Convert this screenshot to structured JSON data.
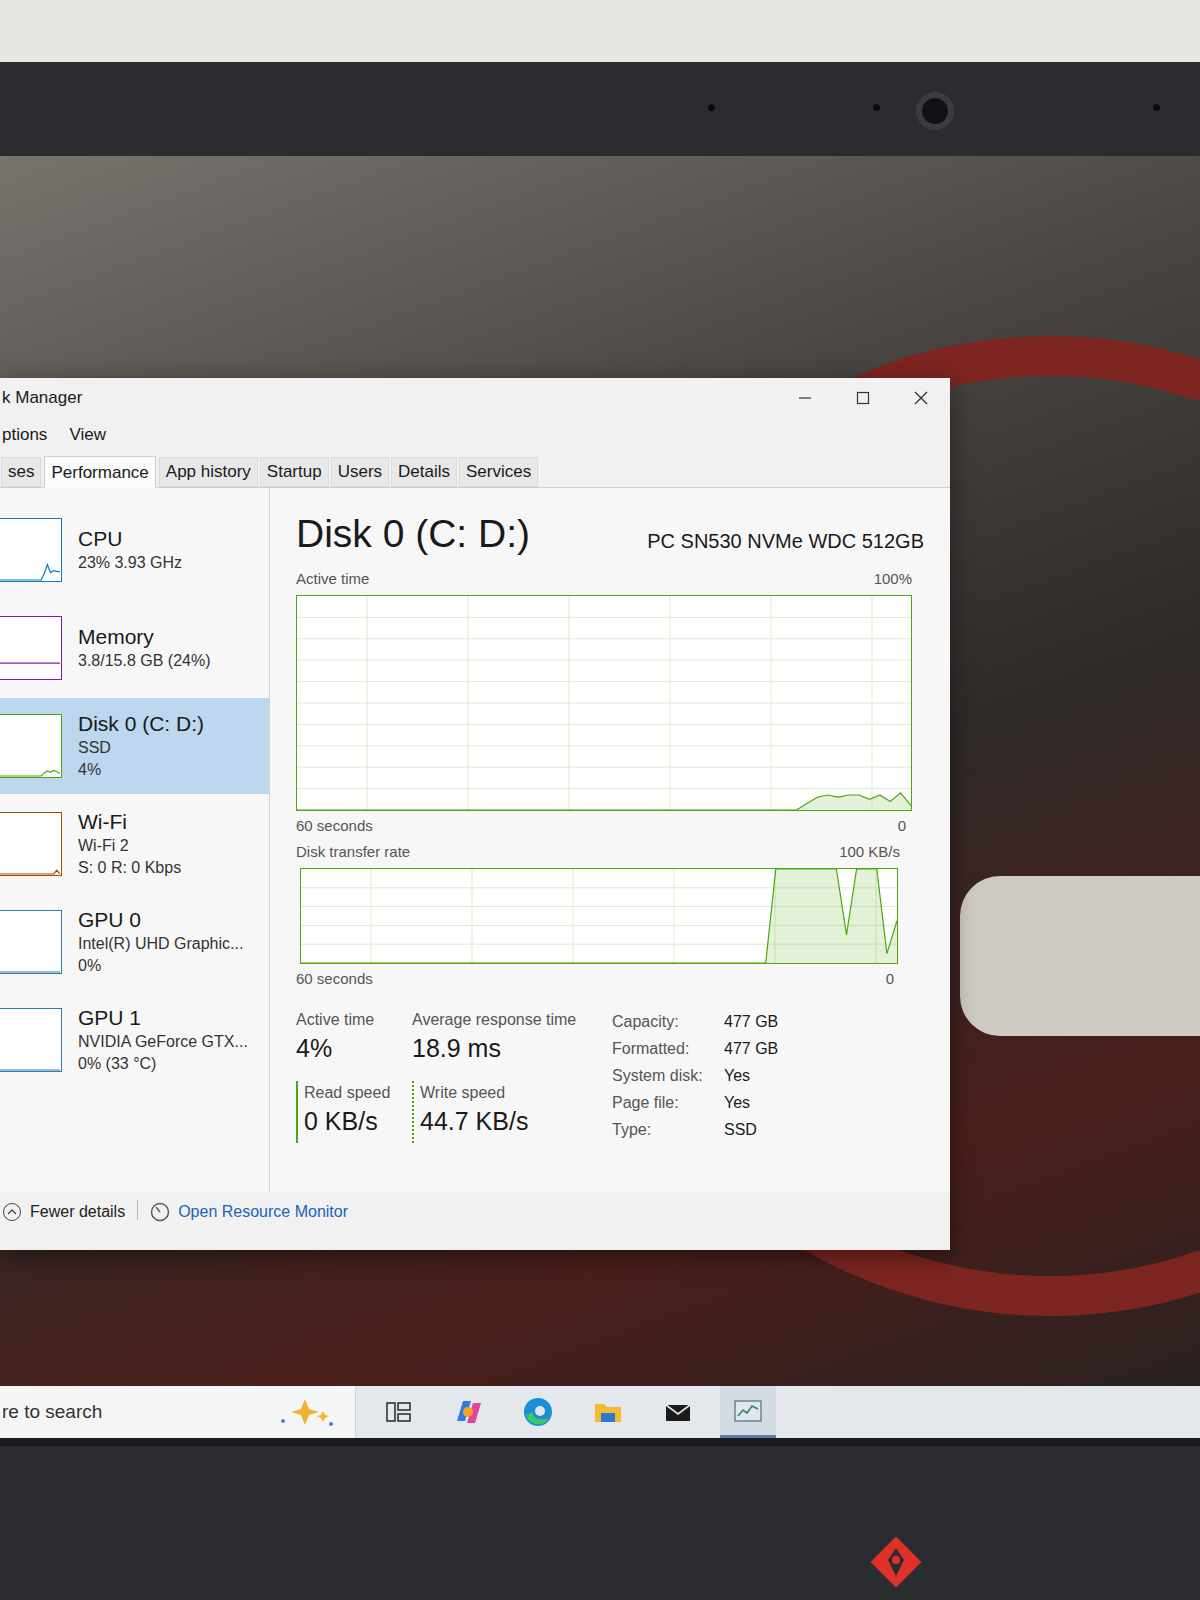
{
  "window": {
    "title": "k Manager"
  },
  "menu": [
    "ptions",
    "View"
  ],
  "tabs": [
    {
      "label": "ses",
      "selected": false
    },
    {
      "label": "Performance",
      "selected": true
    },
    {
      "label": "App history",
      "selected": false
    },
    {
      "label": "Startup",
      "selected": false
    },
    {
      "label": "Users",
      "selected": false
    },
    {
      "label": "Details",
      "selected": false
    },
    {
      "label": "Services",
      "selected": false
    }
  ],
  "sidebar": {
    "items": [
      {
        "name": "CPU",
        "details": [
          "23% 3.93 GHz"
        ],
        "selected": false,
        "color": "#117dbb",
        "sparkline": [
          0,
          0,
          0,
          0,
          0,
          0,
          0,
          0,
          0,
          0,
          0,
          0,
          0,
          0,
          10,
          25,
          12,
          15,
          14,
          13
        ]
      },
      {
        "name": "Memory",
        "details": [
          "3.8/15.8 GB (24%)"
        ],
        "selected": false,
        "color": "#8b12ae",
        "sparkline": [
          24,
          24,
          24,
          24,
          24,
          24,
          24,
          24,
          24,
          24,
          24,
          24,
          24,
          24,
          24,
          24,
          24,
          24,
          24,
          24
        ]
      },
      {
        "name": "Disk 0 (C: D:)",
        "details": [
          "SSD",
          "4%"
        ],
        "selected": true,
        "color": "#4da60c",
        "sparkline": [
          0,
          0,
          0,
          0,
          0,
          0,
          0,
          0,
          0,
          0,
          0,
          0,
          0,
          0,
          5,
          8,
          6,
          9,
          7,
          4
        ]
      },
      {
        "name": "Wi-Fi",
        "details": [
          "Wi-Fi 2",
          "S: 0 R: 0 Kbps"
        ],
        "selected": false,
        "color": "#a74f01",
        "sparkline": [
          0,
          0,
          0,
          0,
          0,
          0,
          0,
          0,
          0,
          0,
          0,
          0,
          0,
          0,
          0,
          0,
          0,
          0,
          6,
          0
        ]
      },
      {
        "name": "GPU 0",
        "details": [
          "Intel(R) UHD Graphic...",
          "0%"
        ],
        "selected": false,
        "color": "#2a7fae",
        "sparkline": [
          0,
          0,
          0,
          0,
          0,
          0,
          0,
          0,
          0,
          0,
          0,
          0,
          0,
          0,
          0,
          0,
          0,
          0,
          0,
          0
        ]
      },
      {
        "name": "GPU 1",
        "details": [
          "NVIDIA GeForce GTX...",
          "0% (33 °C)"
        ],
        "selected": false,
        "color": "#2a7fae",
        "sparkline": [
          0,
          0,
          0,
          0,
          0,
          0,
          0,
          0,
          0,
          0,
          0,
          0,
          0,
          0,
          0,
          0,
          0,
          0,
          0,
          0
        ]
      }
    ]
  },
  "panel": {
    "title": "Disk 0 (C: D:)",
    "model": "PC SN530 NVMe WDC 512GB",
    "charts": [
      {
        "label": "Active time",
        "max": "100%",
        "x_start": "60 seconds",
        "x_end": "0",
        "values": [
          0,
          0,
          0,
          0,
          0,
          0,
          0,
          0,
          0,
          0,
          0,
          0,
          0,
          0,
          0,
          0,
          0,
          0,
          0,
          0,
          0,
          0,
          0,
          0,
          0,
          0,
          0,
          0,
          0,
          0,
          0,
          0,
          0,
          0,
          0,
          0,
          0,
          0,
          0,
          0,
          0,
          0,
          0,
          0,
          0,
          0,
          0,
          0,
          0,
          3,
          6,
          7,
          6,
          7,
          7,
          5,
          7,
          4,
          8,
          2
        ]
      },
      {
        "label": "Disk transfer rate",
        "max": "100 KB/s",
        "x_start": "60 seconds",
        "x_end": "0",
        "values": [
          0,
          0,
          0,
          0,
          0,
          0,
          0,
          0,
          0,
          0,
          0,
          0,
          0,
          0,
          0,
          0,
          0,
          0,
          0,
          0,
          0,
          0,
          0,
          0,
          0,
          0,
          0,
          0,
          0,
          0,
          0,
          0,
          0,
          0,
          0,
          0,
          0,
          0,
          0,
          0,
          0,
          0,
          0,
          0,
          0,
          0,
          0,
          100,
          100,
          100,
          100,
          100,
          100,
          100,
          30,
          100,
          100,
          100,
          10,
          45
        ]
      }
    ],
    "stats": [
      {
        "label": "Active time",
        "value": "4%",
        "kind": "plain"
      },
      {
        "label": "Average response time",
        "value": "18.9 ms",
        "kind": "plain"
      },
      {
        "label": "Read speed",
        "value": "0 KB/s",
        "kind": "read"
      },
      {
        "label": "Write speed",
        "value": "44.7 KB/s",
        "kind": "write"
      }
    ],
    "properties": [
      {
        "label": "Capacity:",
        "value": "477 GB"
      },
      {
        "label": "Formatted:",
        "value": "477 GB"
      },
      {
        "label": "System disk:",
        "value": "Yes"
      },
      {
        "label": "Page file:",
        "value": "Yes"
      },
      {
        "label": "Type:",
        "value": "SSD"
      }
    ]
  },
  "footer": {
    "fewer_details": "Fewer details",
    "resource_monitor": "Open Resource Monitor"
  },
  "taskbar": {
    "search": "re to search",
    "apps": [
      {
        "kind": "task-view",
        "selected": false
      },
      {
        "kind": "copilot",
        "selected": false
      },
      {
        "kind": "edge",
        "selected": false
      },
      {
        "kind": "explorer",
        "selected": false
      },
      {
        "kind": "mail",
        "selected": false
      },
      {
        "kind": "task-manager",
        "selected": true
      }
    ]
  }
}
